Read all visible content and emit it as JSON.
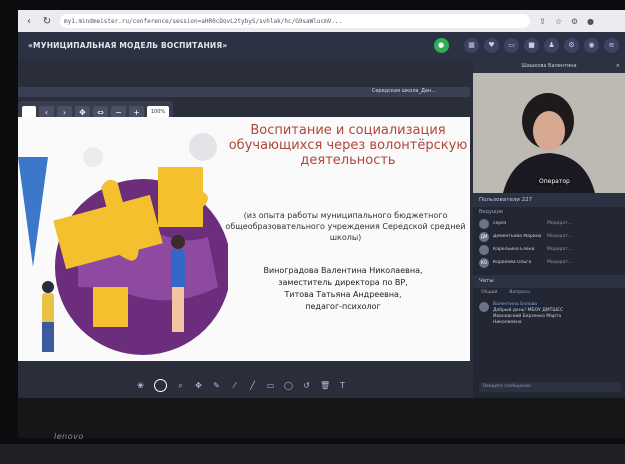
{
  "browser": {
    "url": "my1.mindmeister.ru/conference/session=aHR0cDovL2tybyS/svhlak/hc/G9saWlucmV..."
  },
  "app": {
    "title": "«МУНИЦИПАЛЬНАЯ МОДЕЛЬ ВОСПИТАНИЯ»"
  },
  "slide": {
    "tab_label": "Середская школа_Дан...",
    "zoom": "100%",
    "title": "Воспитание и социализация обучающихся через волонтёрскую деятельность",
    "subtitle": "(из опыта работы муниципального бюджетного общеобразовательного учреждения Середской средней школы)",
    "author1": "Виноградова Валентина Николаевна,",
    "author1_role": "заместитель директора по ВР,",
    "author2": "Титова Татьяна Андреевна,",
    "author2_role": "педагог-психолог"
  },
  "side": {
    "video_header": "Шашкова Валентина",
    "video_label": "Оператор",
    "participants_header": "Пользователи 227",
    "section_label": "Ведущие",
    "participants": [
      {
        "initials": "",
        "name": "сереэ",
        "role": "Модерат..."
      },
      {
        "initials": "ДМ",
        "name": "Дементьева Марина",
        "role": "Модерат..."
      },
      {
        "initials": "",
        "name": "Карельина Елена",
        "role": "Модерат..."
      },
      {
        "initials": "КО",
        "name": "Королева Ольга",
        "role": "Модерат..."
      }
    ],
    "chat_header": "Чаты",
    "chat_tabs": [
      "Общий",
      "Вопросы"
    ],
    "chat_sender": "Валентина Белова",
    "chat_text": "Добрый день! МБОУ ДМТШЕС Ивановский Берзенко Марта Николаевна",
    "chat_placeholder": "Введите сообщение"
  },
  "device": {
    "brand": "lenovo"
  }
}
